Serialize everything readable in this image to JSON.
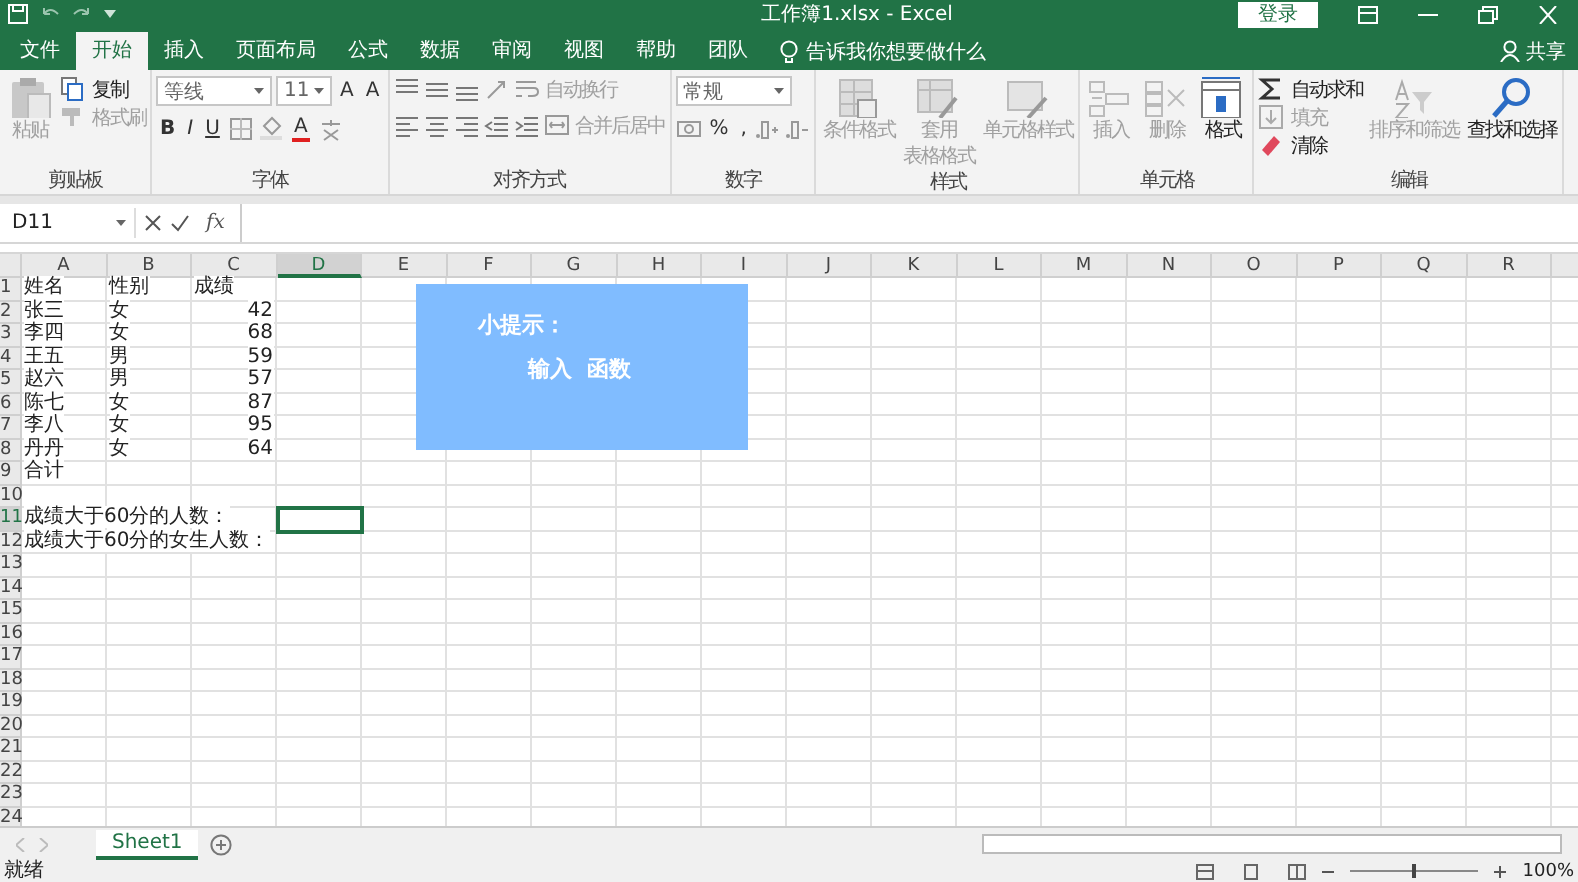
{
  "title_bar": {
    "title": "工作簿1.xlsx  -  Excel",
    "login_button": "登录"
  },
  "tabs": [
    {
      "label": "文件",
      "selected": false
    },
    {
      "label": "开始",
      "selected": true
    },
    {
      "label": "插入",
      "selected": false
    },
    {
      "label": "页面布局",
      "selected": false
    },
    {
      "label": "公式",
      "selected": false
    },
    {
      "label": "数据",
      "selected": false
    },
    {
      "label": "审阅",
      "selected": false
    },
    {
      "label": "视图",
      "selected": false
    },
    {
      "label": "帮助",
      "selected": false
    },
    {
      "label": "团队",
      "selected": false
    }
  ],
  "tell_me": {
    "label": "告诉我你想要做什么"
  },
  "share_button": "共享",
  "ribbon": {
    "groups": [
      {
        "label": "剪贴板",
        "kind": "columns",
        "stacks": [
          [
            {
              "kind": "paste",
              "label": "粘贴",
              "disabled": true
            }
          ],
          [
            {
              "kind": "copy",
              "label": "复制",
              "disabled": false
            },
            {
              "kind": "format_painter",
              "label": "格式刷",
              "disabled": true
            }
          ]
        ]
      },
      {
        "label": "字体",
        "kind": "rows",
        "stacks": [
          [
            {
              "kind": "font_name",
              "value": "等线"
            },
            {
              "kind": "font_size",
              "value": "11"
            },
            {
              "kind": "grow",
              "label": "A"
            },
            {
              "kind": "shrink",
              "label": "A"
            }
          ],
          [
            {
              "kind": "bold",
              "label": "B"
            },
            {
              "kind": "italic",
              "label": "I"
            },
            {
              "kind": "underline",
              "label": "U"
            },
            {
              "kind": "borders"
            },
            {
              "kind": "fill_color"
            },
            {
              "kind": "font_color",
              "label": "A"
            },
            {
              "kind": "phonetic"
            }
          ]
        ]
      },
      {
        "label": "对齐方式",
        "kind": "rows",
        "stacks": [
          [
            {
              "kind": "align_top"
            },
            {
              "kind": "align_middle"
            },
            {
              "kind": "align_bottom"
            },
            {
              "kind": "orientation"
            },
            {
              "kind": "wrap_text",
              "label": "自动换行",
              "disabled": true
            }
          ],
          [
            {
              "kind": "align_left"
            },
            {
              "kind": "align_center"
            },
            {
              "kind": "align_right"
            },
            {
              "kind": "outdent"
            },
            {
              "kind": "indent"
            },
            {
              "kind": "merge",
              "label": "合并后居中",
              "disabled": true
            }
          ]
        ]
      },
      {
        "label": "数字",
        "kind": "rows",
        "stacks": [
          [
            {
              "kind": "number_format",
              "value": "常规"
            }
          ],
          [
            {
              "kind": "currency"
            },
            {
              "kind": "percent",
              "label": "%"
            },
            {
              "kind": "comma",
              "label": ","
            },
            {
              "kind": "inc_decimal"
            },
            {
              "kind": "dec_decimal"
            }
          ]
        ]
      },
      {
        "label": "样式",
        "kind": "columns",
        "stacks": [
          [
            {
              "kind": "conditional",
              "label": "条件格式",
              "disabled": true
            }
          ],
          [
            {
              "kind": "table_format",
              "label": "套用",
              "label_2": "表格格式",
              "disabled": true
            }
          ],
          [
            {
              "kind": "cell_style",
              "label": "单元格样式",
              "disabled": true
            }
          ]
        ]
      },
      {
        "label": "单元格",
        "kind": "columns",
        "stacks": [
          [
            {
              "kind": "insert",
              "label": "插入",
              "disabled": true
            }
          ],
          [
            {
              "kind": "delete",
              "label": "删除",
              "disabled": true
            }
          ],
          [
            {
              "kind": "format",
              "label": "格式",
              "disabled": false
            }
          ]
        ]
      },
      {
        "label": "编辑",
        "kind": "columns",
        "stacks": [
          [
            {
              "kind": "autosum",
              "label": "自动求和",
              "disabled": false
            },
            {
              "kind": "fill",
              "label": "填充",
              "disabled": true
            },
            {
              "kind": "clear",
              "label": "清除",
              "disabled": false
            }
          ],
          [
            {
              "kind": "sort",
              "label": "排序和筛选",
              "disabled": true
            }
          ],
          [
            {
              "kind": "find",
              "label": "查找和选择",
              "disabled": false
            }
          ]
        ]
      }
    ]
  },
  "formula_bar": {
    "name_box": "D11",
    "function_button": "fx"
  },
  "sheet": {
    "columns": [
      {
        "label": "A",
        "selected": false
      },
      {
        "label": "B",
        "selected": false
      },
      {
        "label": "C",
        "selected": false
      },
      {
        "label": "D",
        "selected": true
      },
      {
        "label": "E",
        "selected": false
      },
      {
        "label": "F",
        "selected": false
      },
      {
        "label": "G",
        "selected": false
      },
      {
        "label": "H",
        "selected": false
      },
      {
        "label": "I",
        "selected": false
      },
      {
        "label": "J",
        "selected": false
      },
      {
        "label": "K",
        "selected": false
      },
      {
        "label": "L",
        "selected": false
      },
      {
        "label": "M",
        "selected": false
      },
      {
        "label": "N",
        "selected": false
      },
      {
        "label": "O",
        "selected": false
      },
      {
        "label": "P",
        "selected": false
      },
      {
        "label": "Q",
        "selected": false
      },
      {
        "label": "R",
        "selected": false
      }
    ],
    "rows": [
      {
        "label": "1",
        "selected": false,
        "cells": [
          {
            "text": "姓名",
            "kind": "text"
          },
          {
            "text": "性别",
            "kind": "text"
          },
          {
            "text": "成绩",
            "kind": "text"
          }
        ]
      },
      {
        "label": "2",
        "selected": false,
        "cells": [
          {
            "text": "张三",
            "kind": "text"
          },
          {
            "text": "女",
            "kind": "text"
          },
          {
            "text": "42",
            "kind": "number"
          }
        ]
      },
      {
        "label": "3",
        "selected": false,
        "cells": [
          {
            "text": "李四",
            "kind": "text"
          },
          {
            "text": "女",
            "kind": "text"
          },
          {
            "text": "68",
            "kind": "number"
          }
        ]
      },
      {
        "label": "4",
        "selected": false,
        "cells": [
          {
            "text": "王五",
            "kind": "text"
          },
          {
            "text": "男",
            "kind": "text"
          },
          {
            "text": "59",
            "kind": "number"
          }
        ]
      },
      {
        "label": "5",
        "selected": false,
        "cells": [
          {
            "text": "赵六",
            "kind": "text"
          },
          {
            "text": "男",
            "kind": "text"
          },
          {
            "text": "57",
            "kind": "number"
          }
        ]
      },
      {
        "label": "6",
        "selected": false,
        "cells": [
          {
            "text": "陈七",
            "kind": "text"
          },
          {
            "text": "女",
            "kind": "text"
          },
          {
            "text": "87",
            "kind": "number"
          }
        ]
      },
      {
        "label": "7",
        "selected": false,
        "cells": [
          {
            "text": "李八",
            "kind": "text"
          },
          {
            "text": "女",
            "kind": "text"
          },
          {
            "text": "95",
            "kind": "number"
          }
        ]
      },
      {
        "label": "8",
        "selected": false,
        "cells": [
          {
            "text": "丹丹",
            "kind": "text"
          },
          {
            "text": "女",
            "kind": "text"
          },
          {
            "text": "64",
            "kind": "number"
          }
        ]
      },
      {
        "label": "9",
        "selected": false,
        "cells": [
          {
            "text": "合计",
            "kind": "text"
          }
        ]
      },
      {
        "label": "10",
        "selected": false,
        "cells": []
      },
      {
        "label": "11",
        "selected": true,
        "cells": [
          {
            "text": "成绩大于60分的人数：",
            "kind": "text"
          }
        ]
      },
      {
        "label": "12",
        "selected": false,
        "cells": [
          {
            "text": "成绩大于60分的女生人数：",
            "kind": "text"
          }
        ]
      },
      {
        "label": "13",
        "selected": false,
        "cells": []
      },
      {
        "label": "14",
        "selected": false,
        "cells": []
      },
      {
        "label": "15",
        "selected": false,
        "cells": []
      },
      {
        "label": "16",
        "selected": false,
        "cells": []
      },
      {
        "label": "17",
        "selected": false,
        "cells": []
      },
      {
        "label": "18",
        "selected": false,
        "cells": []
      },
      {
        "label": "19",
        "selected": false,
        "cells": []
      },
      {
        "label": "20",
        "selected": false,
        "cells": []
      },
      {
        "label": "21",
        "selected": false,
        "cells": []
      },
      {
        "label": "22",
        "selected": false,
        "cells": []
      },
      {
        "label": "23",
        "selected": false,
        "cells": []
      },
      {
        "label": "24",
        "selected": false,
        "cells": []
      }
    ]
  },
  "text_box": {
    "title": "小提示：",
    "body": "输入  函数"
  },
  "sheet_tabs": [
    {
      "label": "Sheet1",
      "selected": true
    }
  ],
  "status_bar": {
    "status": "就绪",
    "zoom_slider": {
      "level": 0.5
    },
    "zoom": "100%"
  }
}
